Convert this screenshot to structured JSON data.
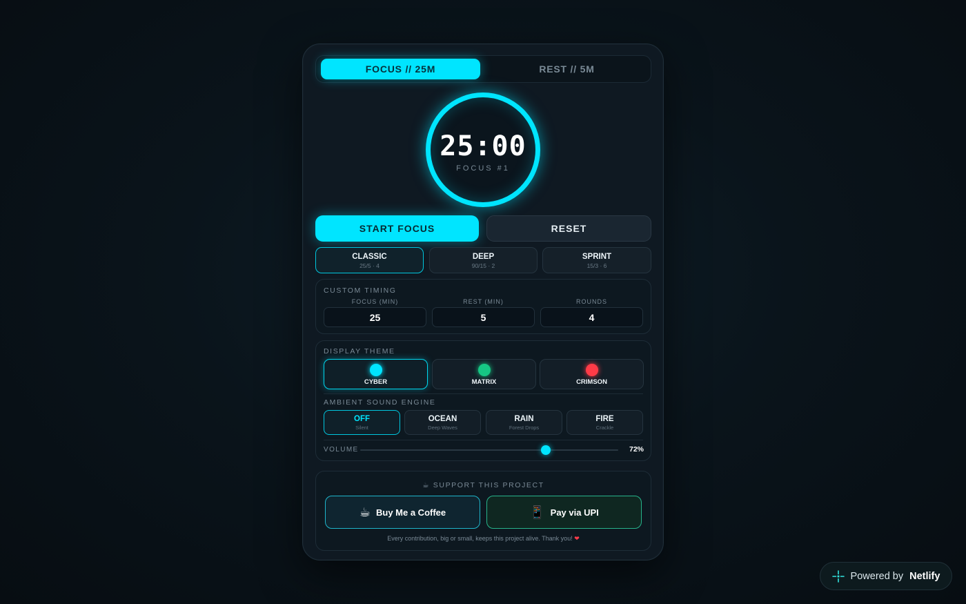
{
  "mode_toggle": {
    "focus_label": "FOCUS // 25M",
    "rest_label": "REST // 5M"
  },
  "timer": {
    "time": "25:00",
    "session": "FOCUS #1"
  },
  "actions": {
    "start_label": "START FOCUS",
    "reset_label": "RESET"
  },
  "presets": [
    {
      "name": "CLASSIC",
      "desc": "25/5 · 4"
    },
    {
      "name": "DEEP",
      "desc": "90/15 · 2"
    },
    {
      "name": "SPRINT",
      "desc": "15/3 · 6"
    }
  ],
  "custom_timing": {
    "title": "CUSTOM TIMING",
    "focus": {
      "label": "FOCUS (MIN)",
      "value": "25"
    },
    "rest": {
      "label": "REST (MIN)",
      "value": "5"
    },
    "rounds": {
      "label": "ROUNDS",
      "value": "4"
    }
  },
  "display_theme": {
    "title": "DISPLAY THEME",
    "themes": [
      {
        "name": "CYBER",
        "color": "#00e5ff"
      },
      {
        "name": "MATRIX",
        "color": "#16c784"
      },
      {
        "name": "CRIMSON",
        "color": "#ff3b47"
      }
    ]
  },
  "ambient": {
    "title": "AMBIENT SOUND ENGINE",
    "sounds": [
      {
        "name": "OFF",
        "desc": "Silent"
      },
      {
        "name": "OCEAN",
        "desc": "Deep Waves"
      },
      {
        "name": "RAIN",
        "desc": "Forest Drops"
      },
      {
        "name": "FIRE",
        "desc": "Crackle"
      }
    ]
  },
  "volume": {
    "label": "VOLUME",
    "value": 72,
    "display": "72%"
  },
  "support": {
    "title": "☕ SUPPORT THIS PROJECT",
    "coffee_label": "Buy Me a Coffee",
    "coffee_icon": "☕",
    "upi_label": "Pay via UPI",
    "upi_icon": "📱",
    "note": "Every contribution, big or small, keeps this project alive. Thank you!",
    "note_heart": "❤"
  },
  "badge": {
    "prefix": "Powered by",
    "brand": "Netlify"
  },
  "colors": {
    "accent": "#00e5ff",
    "matrix": "#16c784",
    "crimson": "#ff3b47"
  }
}
